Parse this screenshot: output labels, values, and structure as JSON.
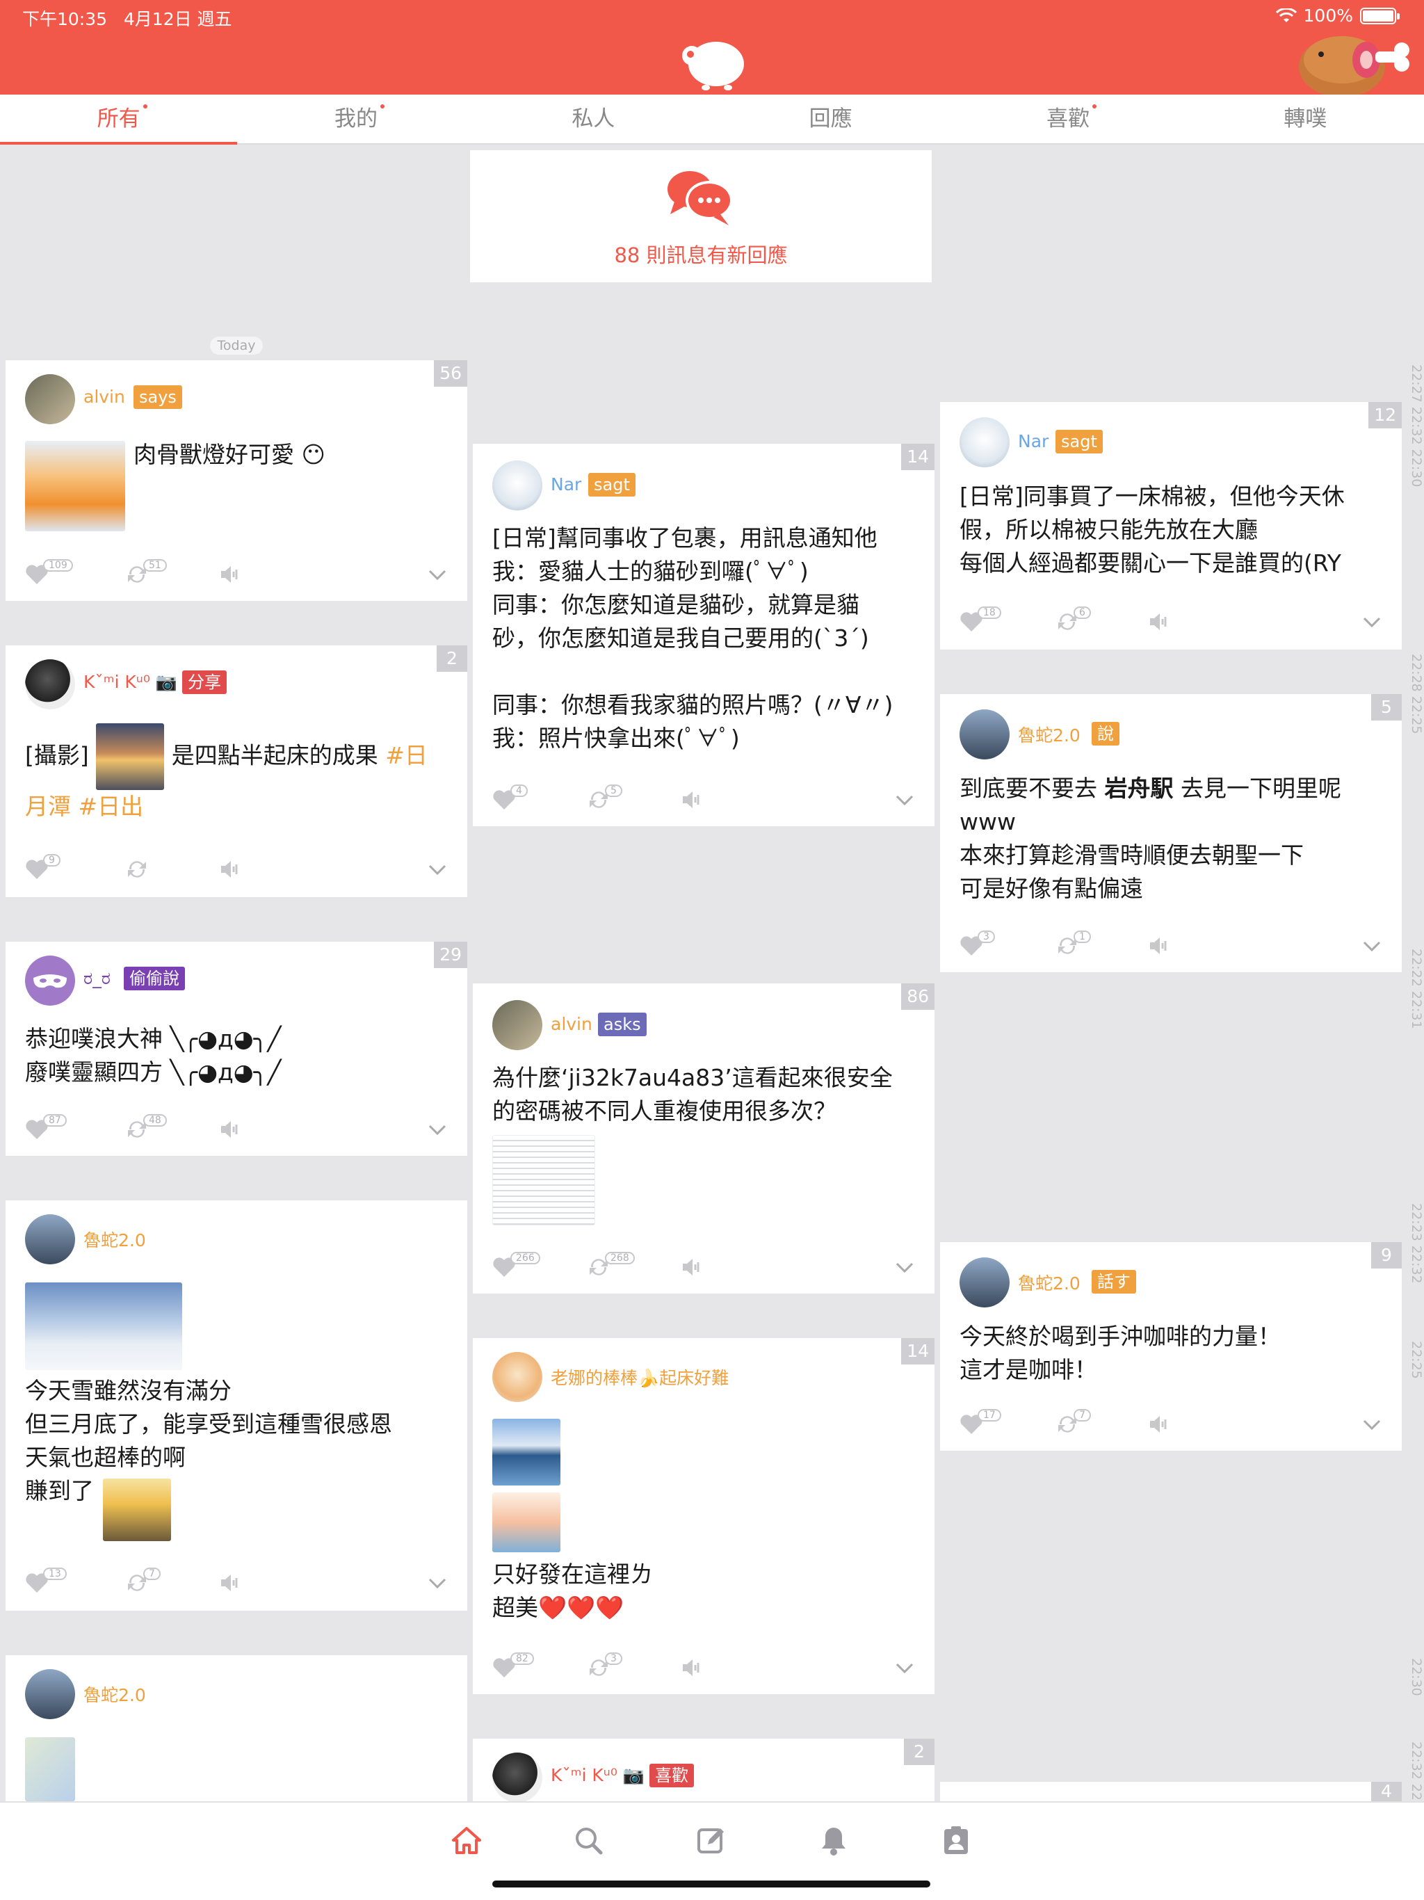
{
  "status_bar": {
    "time": "下午10:35",
    "date": "4月12日 週五",
    "battery": "100%",
    "battery_level": 1.0
  },
  "tabs": [
    {
      "label": "所有",
      "dot": true
    },
    {
      "label": "我的",
      "dot": true
    },
    {
      "label": "私人",
      "dot": false
    },
    {
      "label": "回應",
      "dot": false
    },
    {
      "label": "喜歡",
      "dot": true
    },
    {
      "label": "轉噗",
      "dot": false
    }
  ],
  "notice": {
    "text": "88 則訊息有新回應"
  },
  "today_label": "Today",
  "timeline_marks": [
    "22:27 22:32 22:30",
    "22:28 22:25",
    "22:22 22:31",
    "22:23 22:32",
    "22:25",
    "22:30",
    "22:32 22:"
  ],
  "posts": {
    "p1": {
      "user": "alvin",
      "qualifier": "says",
      "count": "56",
      "text": "肉骨獸燈好可愛 😶",
      "likes": "109",
      "replurks": "51"
    },
    "p2": {
      "user": "Kˇᵐi Kᵘ⁰ 📷",
      "qualifier": "分享",
      "count": "2",
      "text_a": "[攝影]",
      "text_b": "是四點半起床的成果",
      "hashtag1": "#日",
      "hashtag2": "月潭",
      "hashtag3": "#日出",
      "likes": "9"
    },
    "p3": {
      "user": "ರ_ರ",
      "qualifier": "偷偷說",
      "count": "29",
      "line1": "恭迎噗浪大神 ╲╭◕д◕╮╱",
      "line2": "廢噗靈顯四方 ╲╭◕д◕╮╱",
      "likes": "87",
      "replurks": "48"
    },
    "p4": {
      "user": "魯蛇2.0",
      "line1": "今天雪雖然沒有滿分",
      "line2": "但三月底了，能享受到這種雪很感恩",
      "line3": "天氣也超棒的啊",
      "line4": "賺到了",
      "likes": "13",
      "replurks": "7"
    },
    "p5": {
      "user": "魯蛇2.0"
    },
    "p6": {
      "user": "Nar",
      "qualifier": "sagt",
      "count": "14",
      "line1": "[日常]幫同事收了包裹，用訊息通知他",
      "line2": "我：愛貓人士的貓砂到囉(ﾟ∀ﾟ)",
      "line3": "同事：你怎麼知道是貓砂，就算是貓",
      "line4": "砂，你怎麼知道是我自己要用的(`3´)",
      "line5": "同事：你想看我家貓的照片嗎？(〃∀〃)",
      "line6": "我：照片快拿出來(ﾟ∀ﾟ)",
      "likes": "4",
      "replurks": "5"
    },
    "p7": {
      "user": "alvin",
      "qualifier": "asks",
      "count": "86",
      "line1": "為什麼‘ji32k7au4a83’這看起來很安全",
      "line2": "的密碼被不同人重複使用很多次？",
      "likes": "266",
      "replurks": "268"
    },
    "p8": {
      "user": "老娜的棒棒🍌起床好難",
      "count": "14",
      "line1": "只好發在這裡ㄌ",
      "line2": "超美❤️❤️❤️",
      "likes": "82",
      "replurks": "3"
    },
    "p9": {
      "user": "Kˇᵐi Kᵘ⁰ 📷",
      "qualifier": "喜歡",
      "count": "2"
    },
    "p10": {
      "user": "Nar",
      "qualifier": "sagt",
      "count": "12",
      "line1": "[日常]同事買了一床棉被，但他今天休",
      "line2": "假，所以棉被只能先放在大廳",
      "line3": "每個人經過都要關心一下是誰買的(RY",
      "likes": "18",
      "replurks": "6"
    },
    "p11": {
      "user": "魯蛇2.0",
      "qualifier": "說",
      "count": "5",
      "line1_a": "到底要不要去",
      "line1_b": "岩舟駅",
      "line1_c": "去見一下明里呢",
      "line2": "www",
      "line3": "本來打算趁滑雪時順便去朝聖一下",
      "line4": "可是好像有點偏遠",
      "likes": "3",
      "replurks": "1"
    },
    "p12": {
      "user": "魯蛇2.0",
      "qualifier": "話す",
      "count": "9",
      "line1": "今天終於喝到手沖咖啡的力量！",
      "line2": "這才是咖啡！",
      "likes": "17",
      "replurks": "7"
    },
    "p13": {
      "count": "4"
    }
  },
  "colors": {
    "brand": "#f1584a",
    "name": "#f0a03c",
    "says": "#f0a03c",
    "sagt": "#f0a03c",
    "asks": "#6b6bb8",
    "share": "#e24b4b",
    "whisper": "#7a3fb2",
    "shuo": "#f0a03c"
  },
  "icons": [
    "home-icon",
    "search-icon",
    "compose-icon",
    "bell-icon",
    "profile-icon",
    "heart-icon",
    "replurk-icon",
    "mute-icon",
    "chevron-down-icon",
    "chat-bubbles-icon",
    "wifi-icon"
  ]
}
